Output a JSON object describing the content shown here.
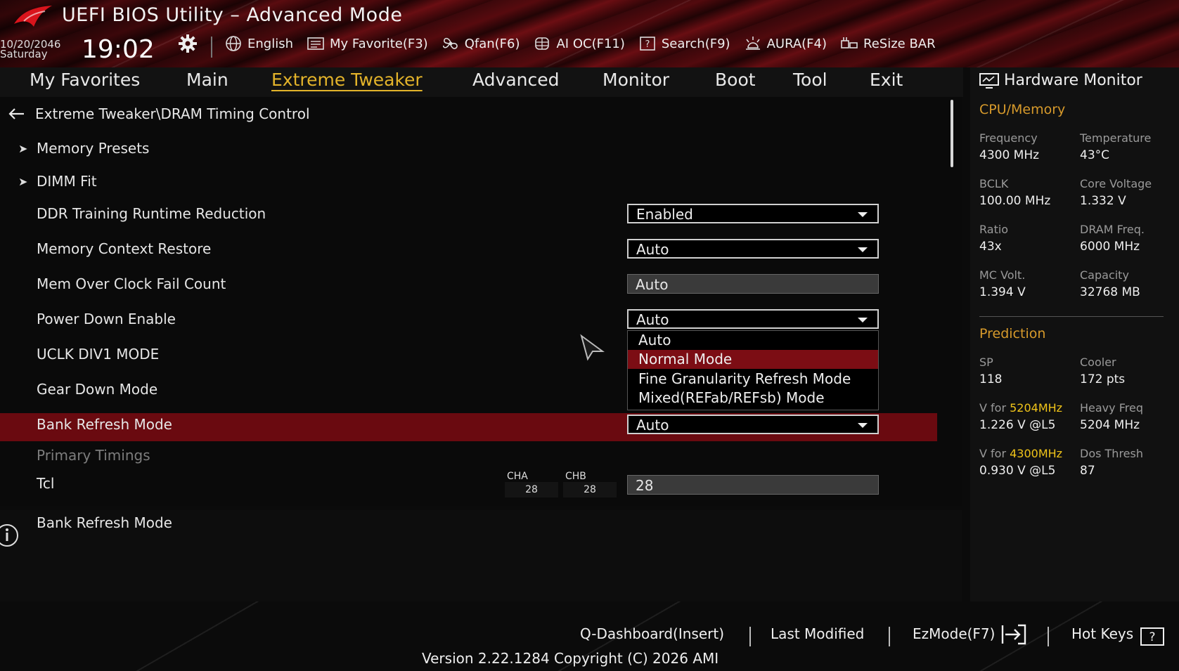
{
  "header": {
    "title": "UEFI BIOS Utility – Advanced Mode",
    "date": "10/20/2046",
    "weekday": "Saturday",
    "time": "19:02",
    "tools": [
      {
        "icon": "globe-icon",
        "label": "English"
      },
      {
        "icon": "favorites-icon",
        "label": "My Favorite(F3)"
      },
      {
        "icon": "fan-icon",
        "label": "Qfan(F6)"
      },
      {
        "icon": "ai-oc-icon",
        "label": "AI OC(F11)"
      },
      {
        "icon": "search-icon",
        "label": "Search(F9)"
      },
      {
        "icon": "aura-icon",
        "label": "AURA(F4)"
      },
      {
        "icon": "resize-bar-icon",
        "label": "ReSize BAR"
      }
    ]
  },
  "tabs": [
    "My Favorites",
    "Main",
    "Extreme Tweaker",
    "Advanced",
    "Monitor",
    "Boot",
    "Tool",
    "Exit"
  ],
  "active_tab": "Extreme Tweaker",
  "breadcrumb": "Extreme Tweaker\\DRAM Timing Control",
  "items": {
    "memory_presets": "Memory Presets",
    "dimm_fit": "DIMM Fit",
    "ddr_training": {
      "label": "DDR Training Runtime Reduction",
      "value": "Enabled"
    },
    "memory_context": {
      "label": "Memory Context Restore",
      "value": "Auto"
    },
    "mem_oc_fail": {
      "label": "Mem Over Clock Fail Count",
      "value": "Auto"
    },
    "power_down": {
      "label": "Power Down Enable",
      "value": "Auto"
    },
    "uclk": {
      "label": "UCLK DIV1 MODE"
    },
    "gear_down": {
      "label": "Gear Down Mode"
    },
    "bank_refresh": {
      "label": "Bank Refresh Mode",
      "value": "Auto"
    },
    "primary_timings": "Primary Timings",
    "tcl": {
      "label": "Tcl",
      "cha_label": "CHA",
      "cha_value": "28",
      "chb_label": "CHB",
      "chb_value": "28",
      "value": "28"
    }
  },
  "dropdown_menu": {
    "options": [
      "Auto",
      "Normal Mode",
      "Fine Granularity Refresh Mode",
      "Mixed(REFab/REFsb) Mode"
    ],
    "selected": "Normal Mode"
  },
  "help": {
    "title": "Bank Refresh Mode"
  },
  "hardware_monitor": {
    "title": "Hardware Monitor",
    "cpu_memory_title": "CPU/Memory",
    "cpu_memory": [
      {
        "label": "Frequency",
        "value": "4300 MHz"
      },
      {
        "label": "Temperature",
        "value": "43°C"
      },
      {
        "label": "BCLK",
        "value": "100.00 MHz"
      },
      {
        "label": "Core Voltage",
        "value": "1.332 V"
      },
      {
        "label": "Ratio",
        "value": "43x"
      },
      {
        "label": "DRAM Freq.",
        "value": "6000 MHz"
      },
      {
        "label": "MC Volt.",
        "value": "1.394 V"
      },
      {
        "label": "Capacity",
        "value": "32768 MB"
      }
    ],
    "prediction_title": "Prediction",
    "prediction": {
      "sp_label": "SP",
      "sp_value": "118",
      "cooler_label": "Cooler",
      "cooler_value": "172 pts",
      "v_for_1_prefix": "V for ",
      "v_for_1_freq": "5204MHz",
      "v_for_1_value": "1.226 V @L5",
      "heavy_freq_label": "Heavy Freq",
      "heavy_freq_value": "5204 MHz",
      "v_for_2_prefix": "V for ",
      "v_for_2_freq": "4300MHz",
      "v_for_2_value": "0.930 V @L5",
      "dos_thresh_label": "Dos Thresh",
      "dos_thresh_value": "87"
    }
  },
  "footer": {
    "q_dashboard": "Q-Dashboard(Insert)",
    "last_modified": "Last Modified",
    "ezmode": "EzMode(F7)",
    "hot_keys": "Hot Keys",
    "version": "Version 2.22.1284 Copyright (C) 2026 AMI"
  },
  "colors": {
    "accent": "#e3b32a",
    "highlight_row": "#6a0a10",
    "menu_selected": "#7c0d14",
    "section_title": "#d79a2b",
    "prediction_highlight": "#f0c419"
  }
}
